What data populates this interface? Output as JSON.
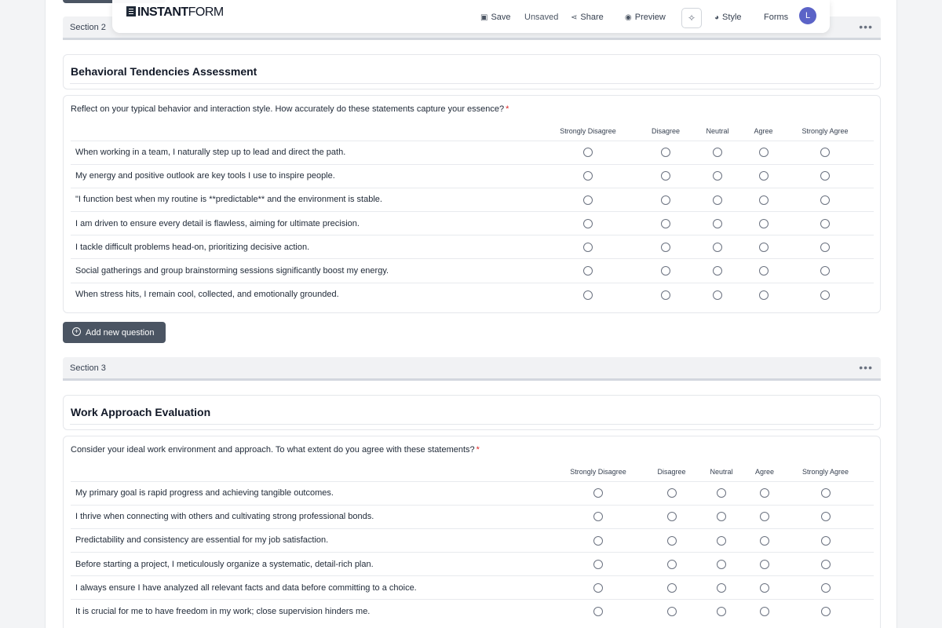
{
  "toolbar": {
    "logo_bold": "INSTANT",
    "logo_thin": "FORM",
    "save_label": "Save",
    "status": "Unsaved",
    "share_label": "Share",
    "preview_label": "Preview",
    "style_label": "Style",
    "forms_label": "Forms",
    "avatar_initial": "L"
  },
  "sections": [
    {
      "label": "Section 2",
      "title": "Behavioral Tendencies Assessment",
      "question": "Reflect on your typical behavior and interaction style. How accurately do these statements capture your essence?",
      "required_mark": "*",
      "columns": [
        "Strongly Disagree",
        "Disagree",
        "Neutral",
        "Agree",
        "Strongly Agree"
      ],
      "rows": [
        "When working in a team, I naturally step up to lead and direct the path.",
        "My energy and positive outlook are key tools I use to inspire people.",
        "\"I function best when my routine is **predictable** and the environment is stable.",
        "I am driven to ensure every detail is flawless, aiming for ultimate precision.",
        "I tackle difficult problems head-on, prioritizing decisive action.",
        "Social gatherings and group brainstorming sessions significantly boost my energy.",
        "When stress hits, I remain cool, collected, and emotionally grounded."
      ]
    },
    {
      "label": "Section 3",
      "title": "Work Approach Evaluation",
      "question": "Consider your ideal work environment and approach. To what extent do you agree with these statements?",
      "required_mark": "*",
      "columns": [
        "Strongly Disagree",
        "Disagree",
        "Neutral",
        "Agree",
        "Strongly Agree"
      ],
      "rows": [
        "My primary goal is rapid progress and achieving tangible outcomes.",
        "I thrive when connecting with others and cultivating strong professional bonds.",
        "Predictability and consistency are essential for my job satisfaction.",
        "Before starting a project, I meticulously organize a systematic, detail-rich plan.",
        "I always ensure I have analyzed all relevant facts and data before committing to a choice.",
        "It is crucial for me to have freedom in my work; close supervision hinders me."
      ]
    }
  ],
  "add_question_label": "Add new question"
}
